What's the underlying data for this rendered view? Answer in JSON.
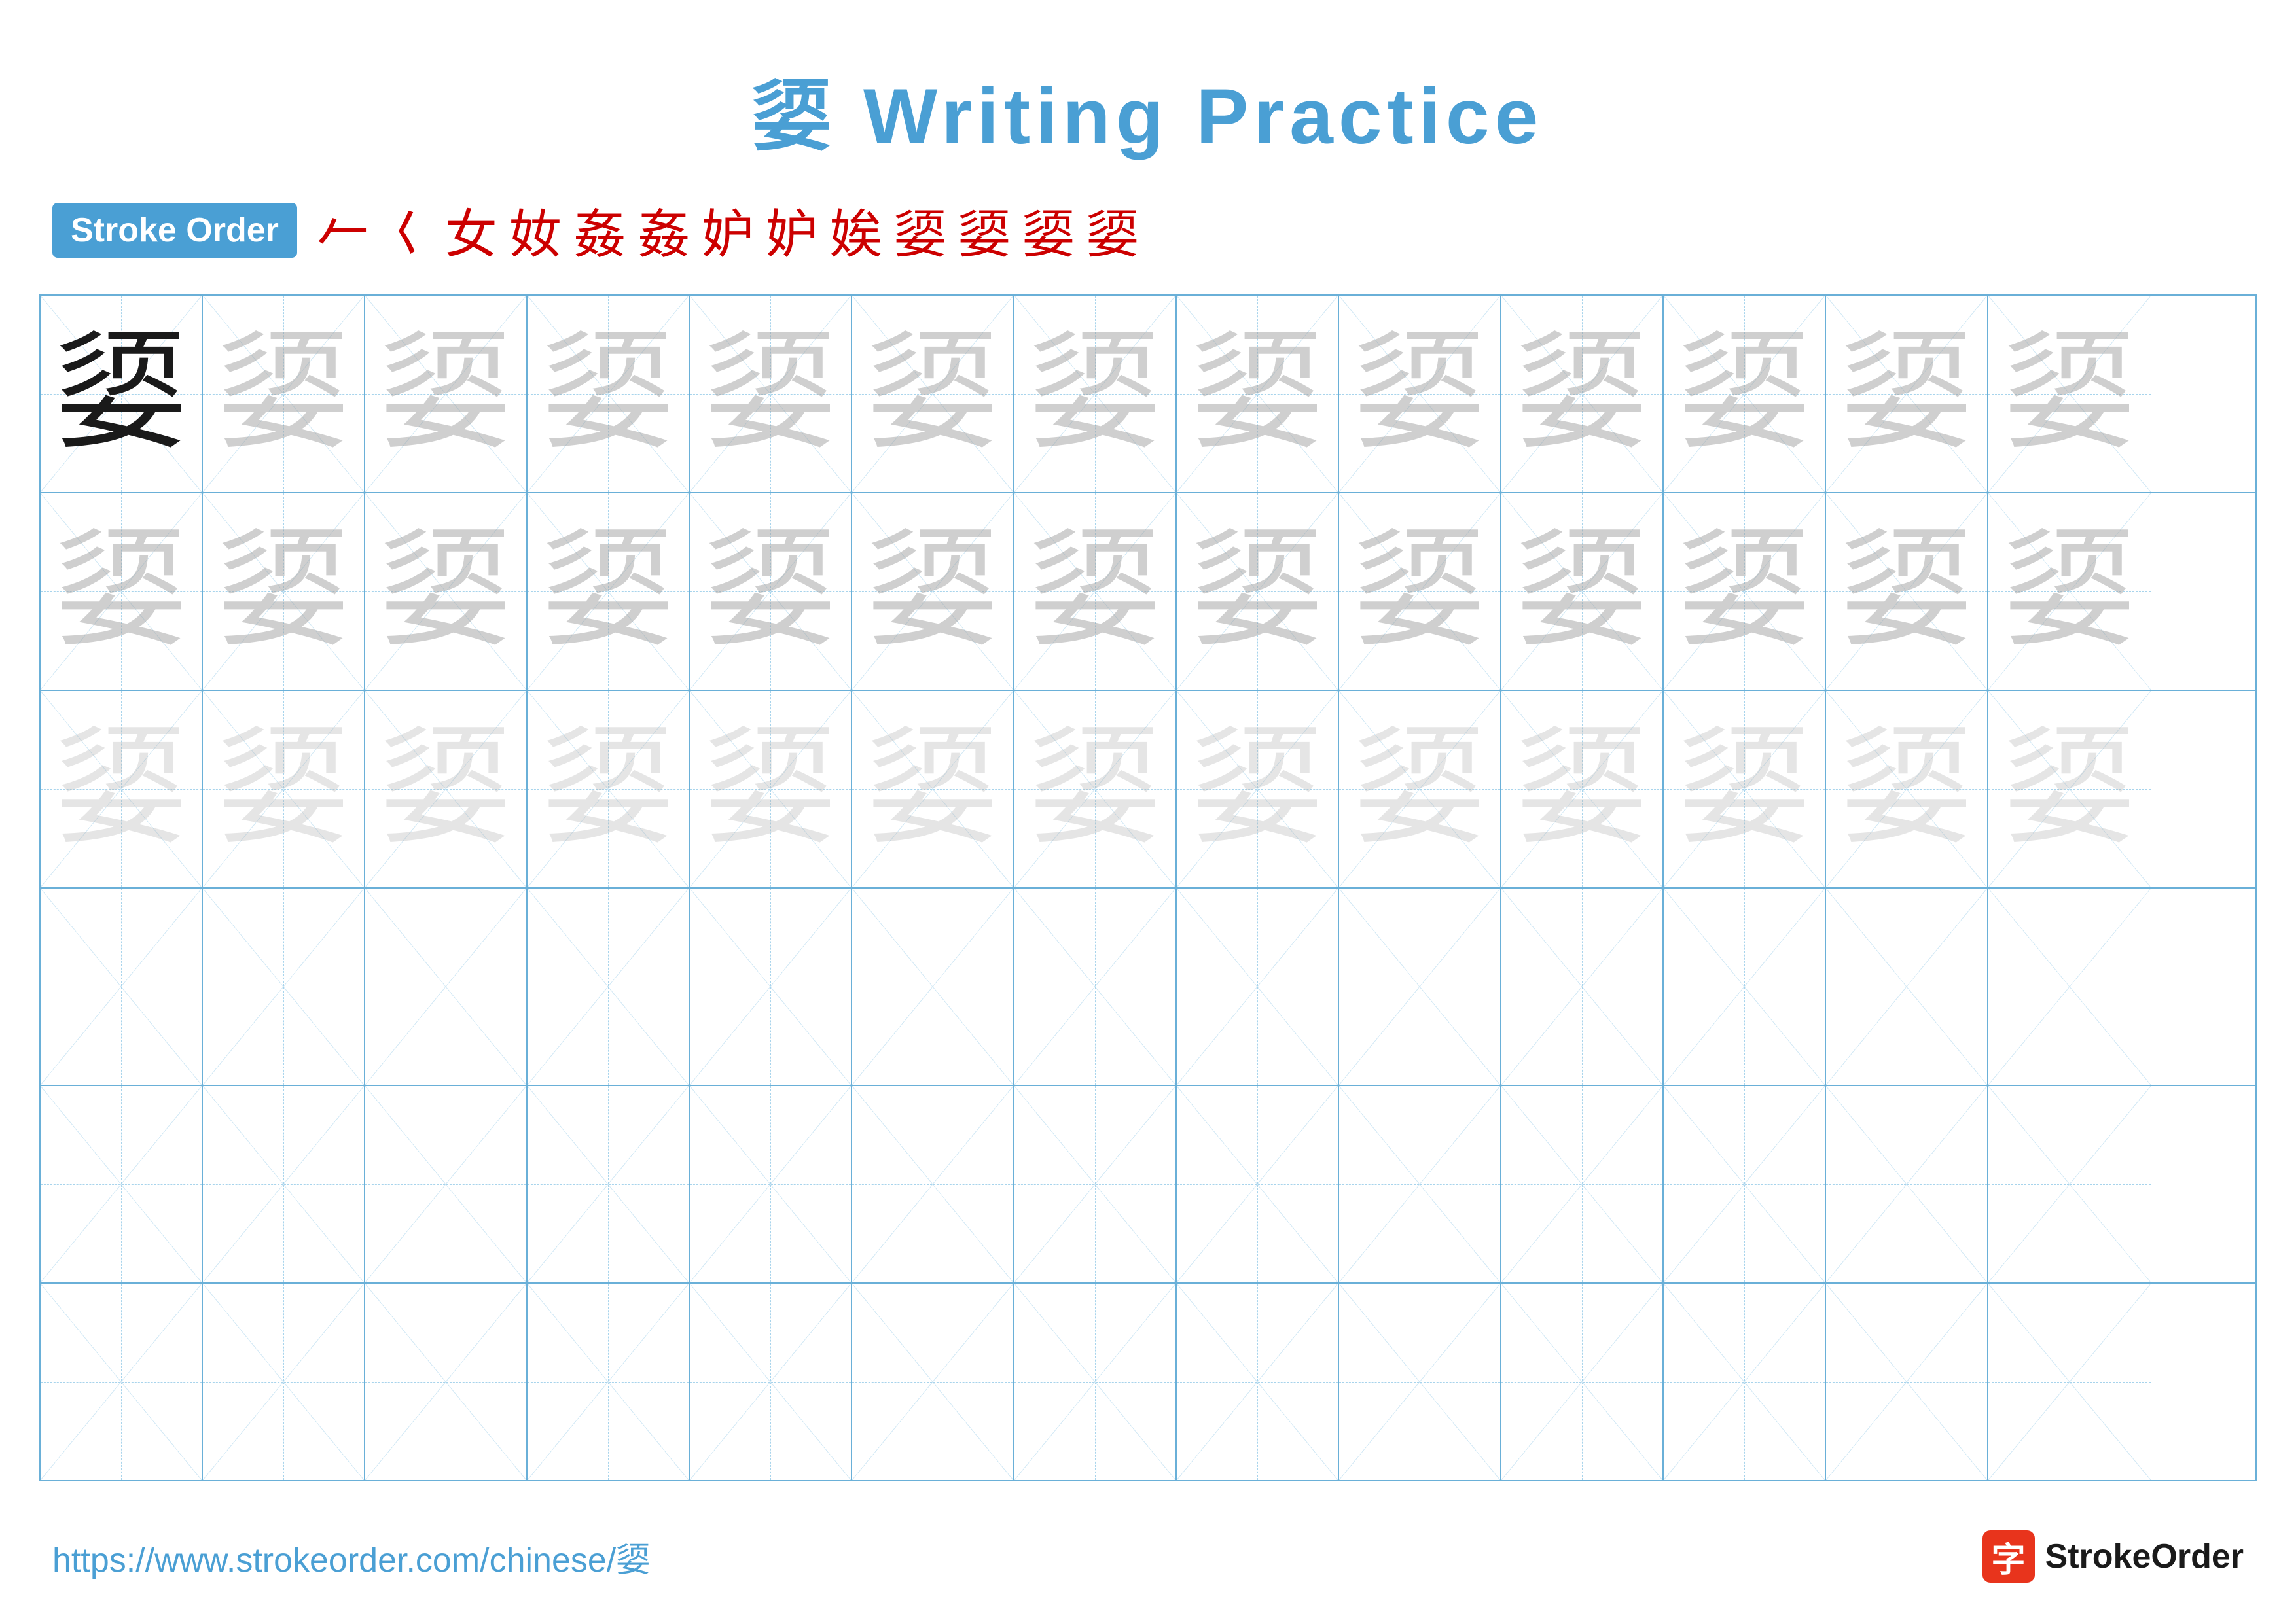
{
  "title": {
    "character": "媭",
    "text": "媭 Writing Practice"
  },
  "stroke_order": {
    "badge_label": "Stroke Order",
    "strokes": [
      "ㄥ",
      "女",
      "女",
      "女",
      "女⁺",
      "女⁺",
      "妒",
      "妒",
      "娭",
      "媭",
      "媭",
      "媭",
      "媭"
    ]
  },
  "grid": {
    "rows": 6,
    "cols": 13,
    "character": "媭",
    "row1_type": "dark_then_light1",
    "row2_type": "light1",
    "row3_type": "light2",
    "row4_type": "empty",
    "row5_type": "empty",
    "row6_type": "empty"
  },
  "footer": {
    "url": "https://www.strokeorder.com/chinese/媭",
    "logo_text": "StrokeOrder",
    "logo_char": "字"
  }
}
